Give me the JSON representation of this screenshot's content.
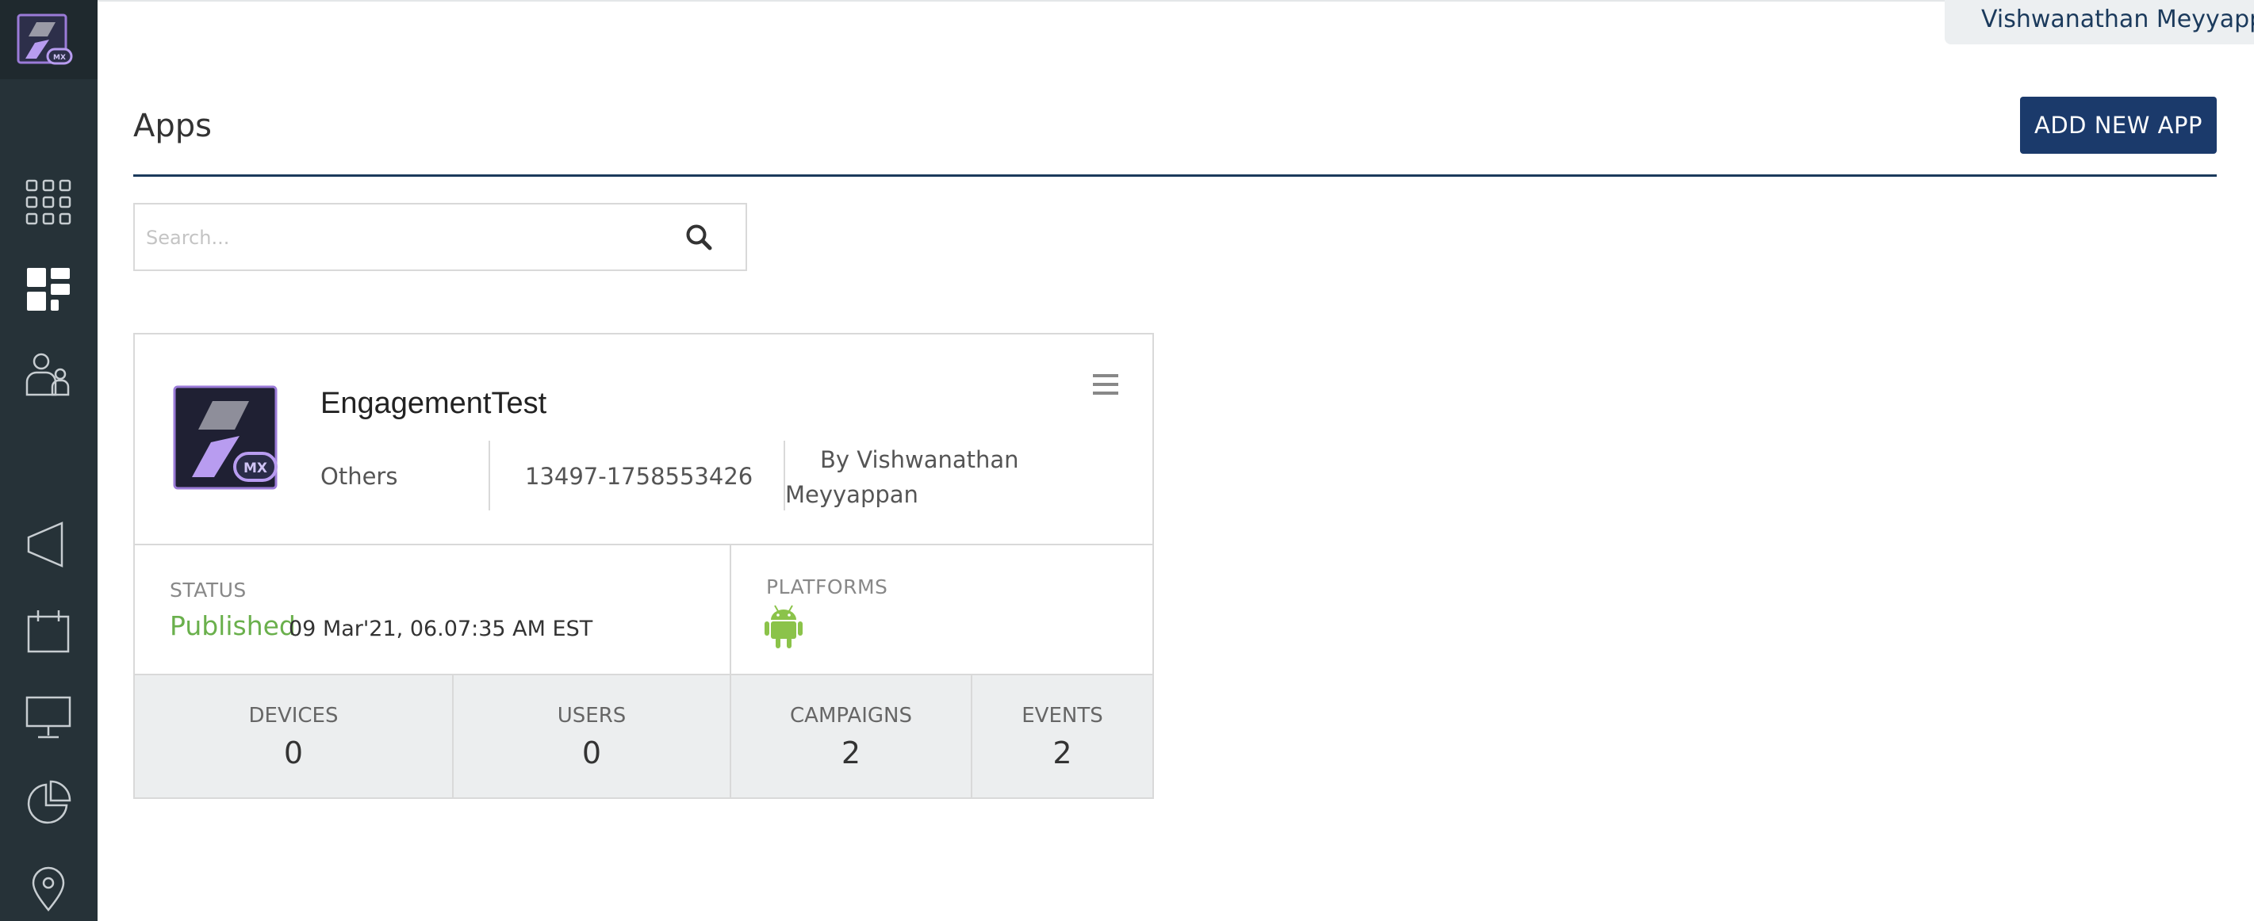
{
  "user": {
    "name": "Vishwanathan Meyyappan"
  },
  "header": {
    "title": "Apps",
    "add_button_label": "ADD NEW APP"
  },
  "search": {
    "placeholder": "Search..."
  },
  "sidebar": {
    "icons": [
      "apps-grid-icon",
      "dashboard-icon",
      "users-icon",
      "megaphone-icon",
      "calendar-icon",
      "monitor-icon",
      "pie-chart-icon",
      "location-pin-icon"
    ],
    "active": "dashboard-icon"
  },
  "app_card": {
    "name": "EngagementTest",
    "category": "Others",
    "app_id": "13497-1758553426",
    "by_line_1": "By Vishwanathan",
    "by_line_2": "Meyyappan",
    "status_label": "STATUS",
    "status_value": "Published",
    "status_date": "09 Mar'21, 06.07:35 AM EST",
    "platforms_label": "PLATFORMS",
    "platforms": [
      "android"
    ],
    "stats": [
      {
        "label": "DEVICES",
        "value": "0"
      },
      {
        "label": "USERS",
        "value": "0"
      },
      {
        "label": "CAMPAIGNS",
        "value": "2"
      },
      {
        "label": "EVENTS",
        "value": "2"
      }
    ]
  },
  "colors": {
    "sidebar": "#263238",
    "primary_button": "#1b3a6b",
    "published_green": "#6ab04c",
    "android_green": "#8bc34a"
  }
}
